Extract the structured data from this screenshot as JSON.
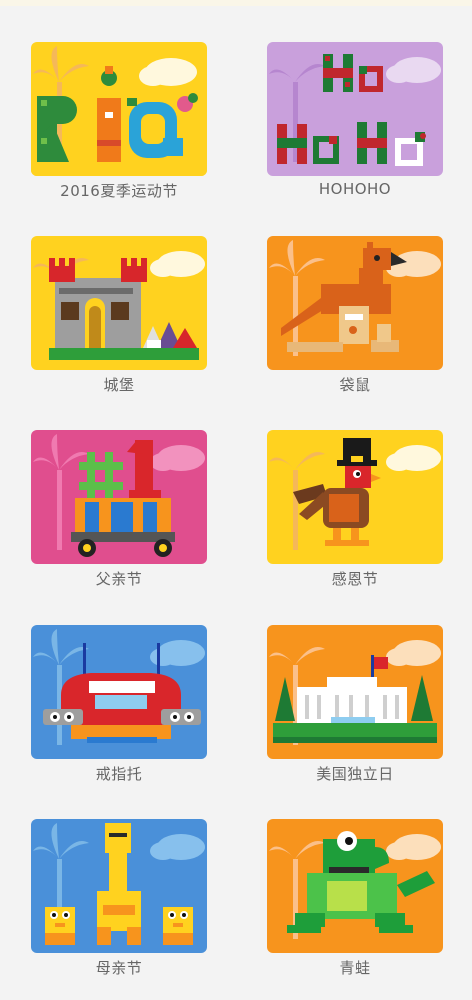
{
  "projects": [
    {
      "label": "2016夏季运动节",
      "bg": "#ffd21f",
      "art": "rio"
    },
    {
      "label": "HOHOHO",
      "bg": "#c9a0dc",
      "art": "hohoho"
    },
    {
      "label": "城堡",
      "bg": "#ffd21f",
      "art": "castle"
    },
    {
      "label": "袋鼠",
      "bg": "#f7941d",
      "art": "kangaroo"
    },
    {
      "label": "父亲节",
      "bg": "#e04e8e",
      "art": "fathers-day"
    },
    {
      "label": "感恩节",
      "bg": "#ffd21f",
      "art": "turkey"
    },
    {
      "label": "戒指托",
      "bg": "#4a90d9",
      "art": "ring-holder"
    },
    {
      "label": "美国独立日",
      "bg": "#f7941d",
      "art": "white-house"
    },
    {
      "label": "母亲节",
      "bg": "#4a90d9",
      "art": "mothers-day"
    },
    {
      "label": "青蛙",
      "bg": "#f7941d",
      "art": "frog"
    }
  ]
}
